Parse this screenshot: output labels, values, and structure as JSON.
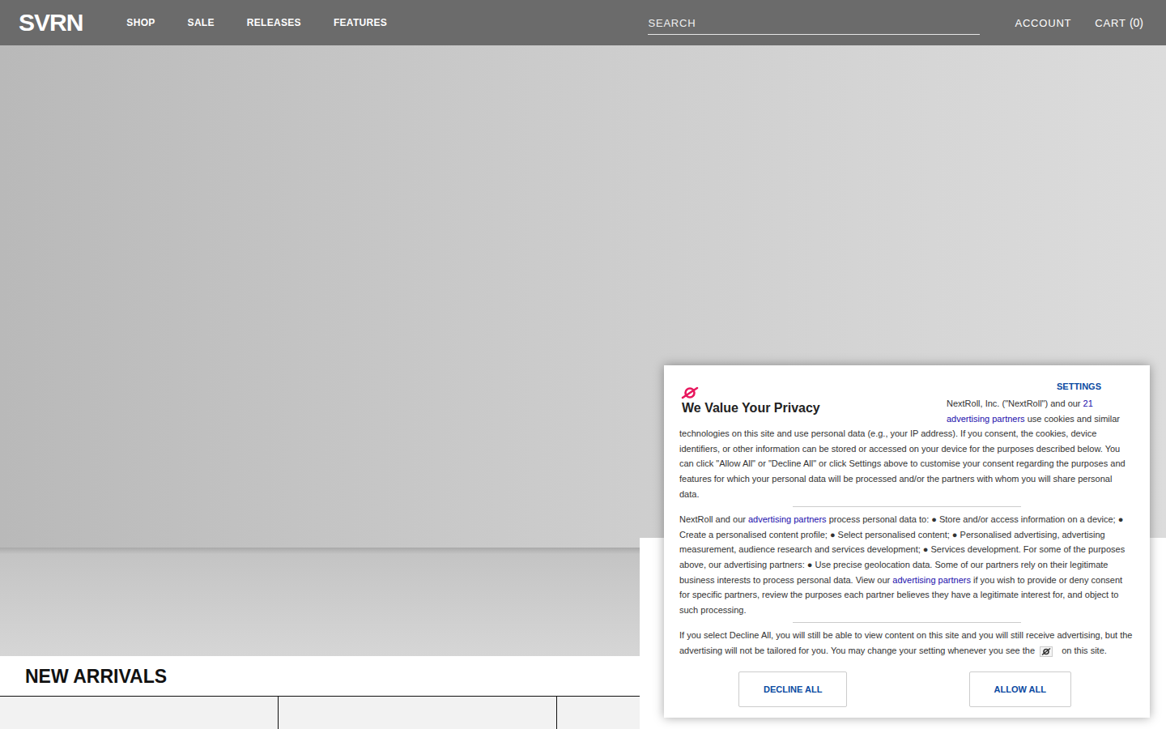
{
  "header": {
    "logo": "SVRN",
    "nav": [
      {
        "label": "SHOP"
      },
      {
        "label": "SALE"
      },
      {
        "label": "RELEASES"
      },
      {
        "label": "FEATURES"
      }
    ],
    "search": {
      "placeholder": "SEARCH"
    },
    "account": "ACCOUNT",
    "cart": {
      "label": "CART",
      "count": "(0)"
    }
  },
  "new_arrivals": {
    "title": "NEW ARRIVALS",
    "cards": [
      {},
      {},
      {},
      {},
      {}
    ]
  },
  "consent": {
    "title": "We Value Your Privacy",
    "settings": "SETTINGS",
    "paragraphs": [
      [
        {
          "kind": "text",
          "text": "NextRoll, Inc. (\"NextRoll\") and our "
        },
        {
          "kind": "link",
          "text": "21 advertising partners"
        },
        {
          "kind": "text",
          "text": " use cookies and similar technologies on this site and use personal data (e.g., your IP address). If you consent, the cookies, device identifiers, or other information can be stored or accessed on your device for the purposes described below. You can click \"Allow All\" or \"Decline All\" or click Settings above to customise your consent regarding the purposes and features for which your personal data will be processed and/or the partners with whom you will share personal data."
        }
      ],
      [
        {
          "kind": "text",
          "text": "NextRoll and our "
        },
        {
          "kind": "link",
          "text": "advertising partners"
        },
        {
          "kind": "text",
          "text": " process personal data to: ● Store and/or access information on a device; ● Create a personalised content profile; ● Select personalised content; ● Personalised advertising, advertising measurement, audience research and services development; ● Services development. For some of the purposes above, our advertising partners: ● Use precise geolocation data. Some of our partners rely on their legitimate business interests to process personal data. View our "
        },
        {
          "kind": "link",
          "text": "advertising partners"
        },
        {
          "kind": "text",
          "text": " if you wish to provide or deny consent for specific partners, review the purposes each partner believes they have a legitimate interest for, and object to such processing."
        }
      ],
      [
        {
          "kind": "text",
          "text": "If you select Decline All, you will still be able to view content on this site and you will still receive advertising, but the advertising will not be tailored for you. You may change your setting whenever you see the "
        },
        {
          "kind": "icon",
          "text": ""
        },
        {
          "kind": "text",
          "text": " on this site."
        }
      ]
    ],
    "buttons": [
      {
        "label": "DECLINE ALL"
      },
      {
        "label": "ALLOW ALL"
      }
    ]
  }
}
